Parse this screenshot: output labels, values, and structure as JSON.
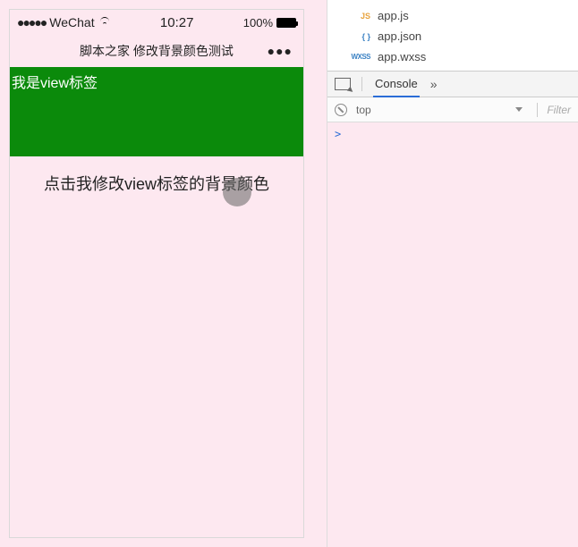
{
  "status": {
    "carrier": "WeChat",
    "signal_dots": "●●●●●",
    "time": "10:27",
    "battery_pct": "100%"
  },
  "titlebar": {
    "title": "脚本之家 修改背景颜色测试",
    "more": "●●●"
  },
  "view": {
    "text": "我是view标签"
  },
  "button": {
    "label": "点击我修改view标签的背景颜色"
  },
  "files": [
    {
      "badge": "JS",
      "badge_class": "js-badge",
      "name": "app.js"
    },
    {
      "badge": "{ }",
      "badge_class": "json-badge",
      "name": "app.json"
    },
    {
      "badge": "WXSS",
      "badge_class": "wxss-badge",
      "name": "app.wxss"
    }
  ],
  "devtools": {
    "tab_console": "Console",
    "more": "»",
    "context": "top",
    "filter_placeholder": "Filter",
    "prompt": ">"
  }
}
